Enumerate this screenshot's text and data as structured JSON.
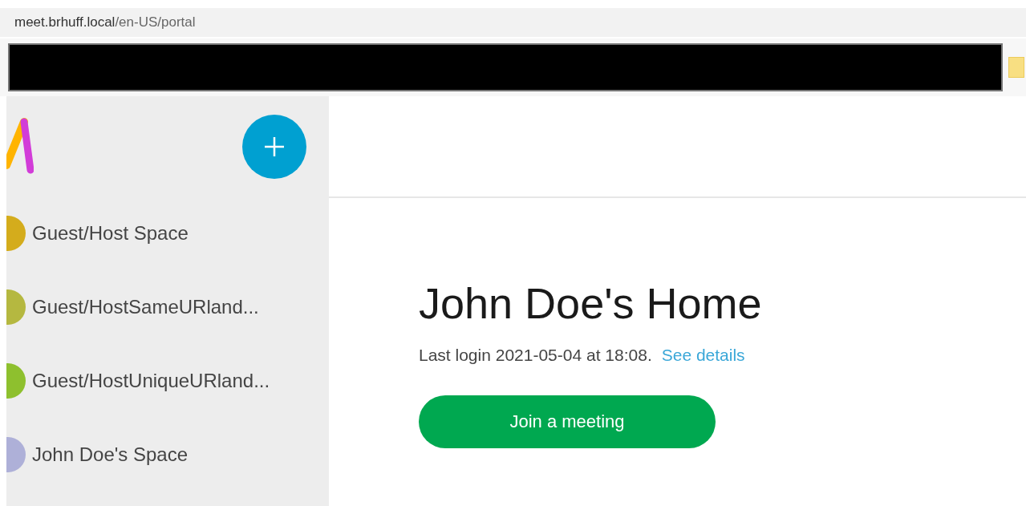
{
  "address_bar": {
    "host": "meet.brhuff.local",
    "path": "/en-US/portal"
  },
  "sidebar": {
    "items": [
      {
        "label": "Guest/Host Space",
        "color": "#d4ac1c"
      },
      {
        "label": "Guest/HostSameURland...",
        "color": "#b5b840"
      },
      {
        "label": "Guest/HostUniqueURland...",
        "color": "#8ec02e"
      },
      {
        "label": "John Doe's Space",
        "color": "#aeb0d8"
      }
    ]
  },
  "main": {
    "title": "John Doe's Home",
    "last_login": "Last login 2021-05-04 at 18:08.",
    "details_link": "See details",
    "join_button": "Join a meeting"
  }
}
